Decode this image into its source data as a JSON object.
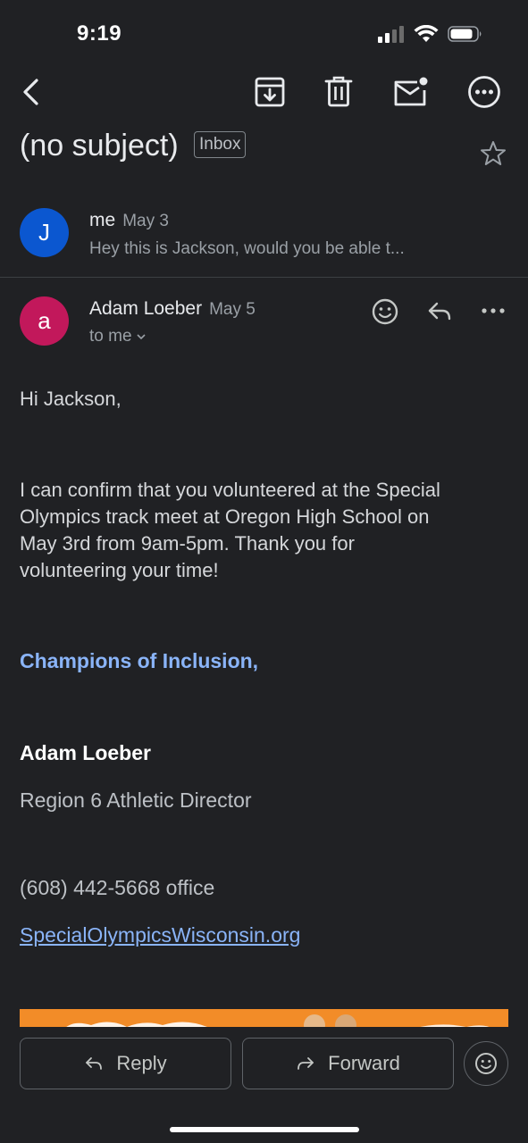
{
  "status": {
    "time": "9:19"
  },
  "header": {
    "subject": "(no subject)",
    "label_chip": "Inbox"
  },
  "thread": {
    "collapsed_message": {
      "avatar_letter": "J",
      "avatar_color": "#0b57d0",
      "sender": "me",
      "date": "May 3",
      "snippet": "Hey this is Jackson, would you be able t..."
    },
    "open_message": {
      "avatar_letter": "a",
      "avatar_color": "#c2185b",
      "sender": "Adam Loeber",
      "date": "May 5",
      "recipient": "to me"
    }
  },
  "body": {
    "greeting": "Hi Jackson,",
    "paragraph_lines": [
      "I can confirm that you volunteered at the Special",
      "Olympics track meet at Oregon High School on",
      "May 3rd from 9am-5pm. Thank you for",
      "volunteering your time!"
    ],
    "closing": "Champions of Inclusion,",
    "signature_name": "Adam Loeber",
    "signature_title": "Region 6 Athletic Director",
    "signature_phone": "(608) 442-5668 office",
    "signature_url": "SpecialOlympicsWisconsin.org"
  },
  "actions": {
    "reply_label": "Reply",
    "forward_label": "Forward"
  },
  "colors": {
    "background": "#202124",
    "link": "#8ab4f8",
    "banner": "#f28c28"
  }
}
